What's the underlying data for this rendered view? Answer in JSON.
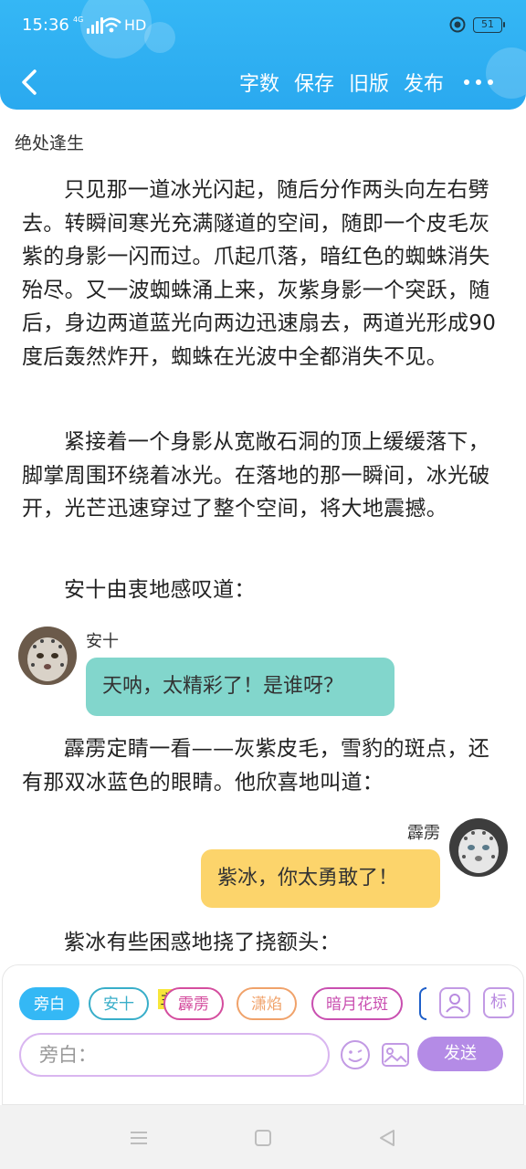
{
  "status_bar": {
    "time": "15:36",
    "network": "4G",
    "hd": "HD",
    "battery": "51"
  },
  "toolbar": {
    "actions": [
      "字数",
      "保存",
      "旧版",
      "发布"
    ]
  },
  "chapter": {
    "title": "绝处逢生",
    "paragraphs": [
      "只见那一道冰光闪起，随后分作两头向左右劈去。转瞬间寒光充满隧道的空间，随即一个皮毛灰紫的身影一闪而过。爪起爪落，暗红色的蜘蛛消失殆尽。又一波蜘蛛涌上来，灰紫身影一个突跃，随后，身边两道蓝光向两边迅速扇去，两道光形成90度后轰然炸开，蜘蛛在光波中全都消失不见。",
      "紧接着一个身影从宽敞石洞的顶上缓缓落下，脚掌周围环绕着冰光。在落地的那一瞬间，冰光破开，光芒迅速穿过了整个空间，将大地震撼。",
      "安十由衷地感叹道：",
      "霹雳定睛一看——灰紫皮毛，雪豹的斑点，还有那双冰蓝色的眼睛。他欣喜地叫道：",
      "紫冰有些困惑地挠了挠额头："
    ],
    "dialogues": [
      {
        "speaker": "安十",
        "text": "天呐，太精彩了！是谁呀？"
      },
      {
        "speaker": "霹雳",
        "text": "紫冰，你太勇敢了！"
      }
    ]
  },
  "editor": {
    "roles": [
      "旁白",
      "安十",
      "霹雳",
      "潇焰",
      "暗月花斑"
    ],
    "main_tag": "主",
    "tools": [
      "user-icon",
      "tag-icon"
    ],
    "tag_label": "标",
    "input_placeholder": "旁白：",
    "send_label": "发送"
  },
  "colors": {
    "header": "#2aa9ef",
    "narration_chip": "#34b8f5",
    "bubble_left": "#82d6cc",
    "bubble_right": "#fcd46b",
    "send": "#b48be6"
  }
}
